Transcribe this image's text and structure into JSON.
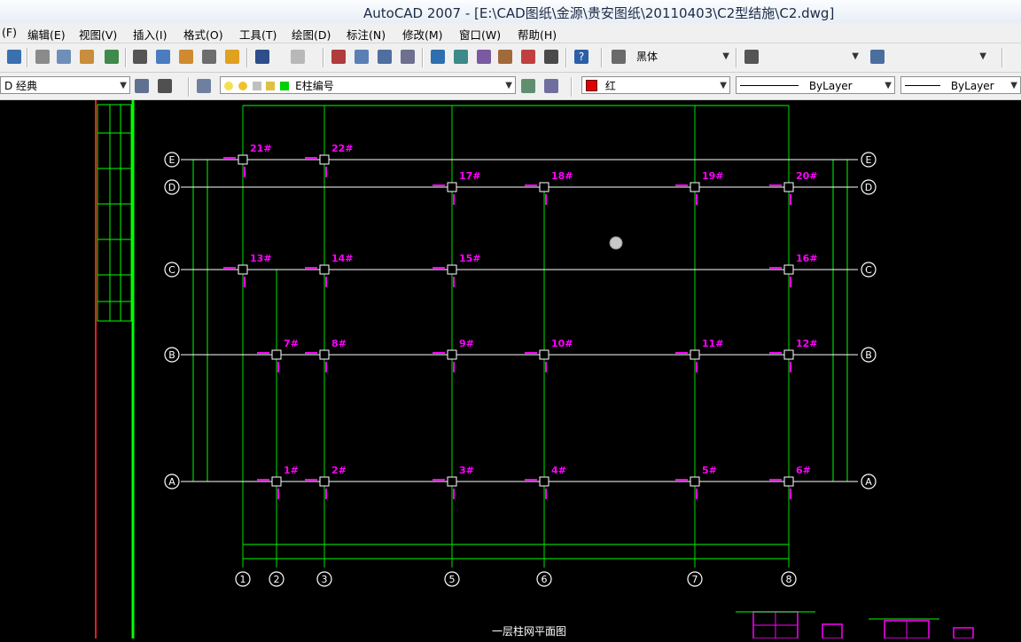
{
  "window": {
    "title": "AutoCAD 2007 - [E:\\CAD图纸\\金源\\贵安图纸\\20110403\\C2型结施\\C2.dwg]"
  },
  "menu": [
    "(F)",
    "编辑(E)",
    "视图(V)",
    "插入(I)",
    "格式(O)",
    "工具(T)",
    "绘图(D)",
    "标注(N)",
    "修改(M)",
    "窗口(W)",
    "帮助(H)"
  ],
  "toolbar": {
    "text_style": "黑体",
    "workspace": "D 经典",
    "layer": "E柱编号",
    "color": "红",
    "linetype": "ByLayer",
    "lineweight": "ByLayer"
  },
  "drawing": {
    "grid_rows": [
      "E",
      "D",
      "C",
      "B",
      "A"
    ],
    "grid_cols": [
      "1",
      "2",
      "3",
      "5",
      "6",
      "7",
      "8"
    ],
    "column_tags": {
      "E": [
        "21#",
        "22#"
      ],
      "D": [
        "17#",
        "18#",
        "19#",
        "20#"
      ],
      "C": [
        "13#",
        "14#",
        "15#",
        "16#"
      ],
      "B": [
        "7#",
        "8#",
        "9#",
        "10#",
        "11#",
        "12#"
      ],
      "A": [
        "1#",
        "2#",
        "3#",
        "4#",
        "5#",
        "6#"
      ]
    },
    "plan_caption": "一层柱网平面图",
    "colors": {
      "grid": "#00e000",
      "dim": "#00ff00",
      "axis": "#ffffff",
      "tag": "#ff00ff"
    }
  }
}
